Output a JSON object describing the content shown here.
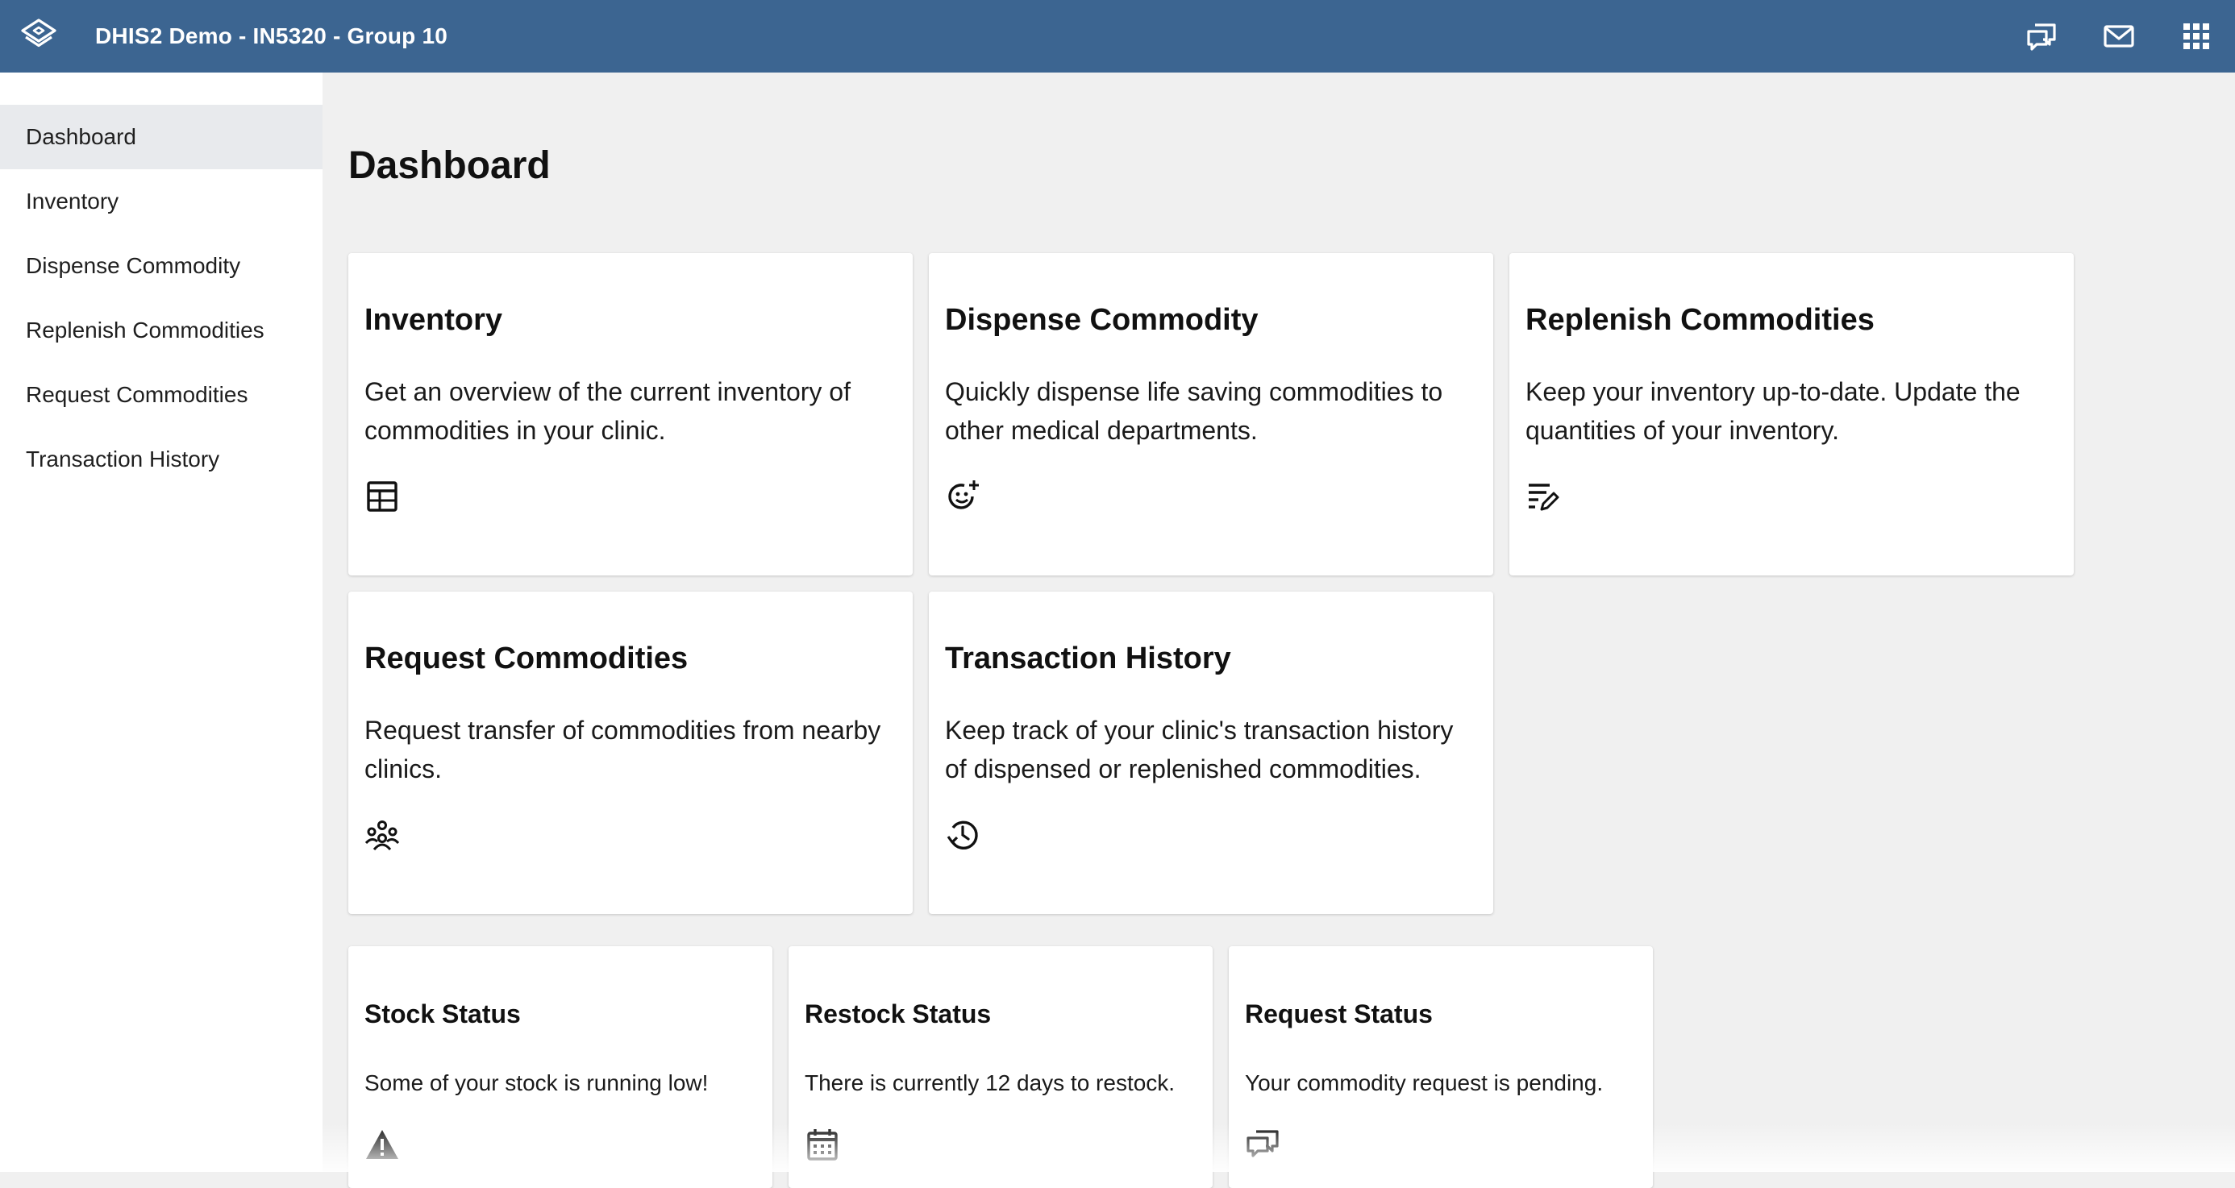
{
  "header": {
    "title": "DHIS2 Demo - IN5320 - Group 10",
    "logo_icon": "dhis2-layers-logo",
    "icons": [
      "interpretations-icon",
      "messages-icon",
      "apps-grid-icon"
    ],
    "bg_color": "#3c6591"
  },
  "sidebar": {
    "items": [
      {
        "label": "Dashboard",
        "active": true
      },
      {
        "label": "Inventory"
      },
      {
        "label": "Dispense Commodity"
      },
      {
        "label": "Replenish Commodities"
      },
      {
        "label": "Request Commodities"
      },
      {
        "label": "Transaction History"
      }
    ]
  },
  "main": {
    "title": "Dashboard",
    "cards": [
      {
        "title": "Inventory",
        "description": "Get an overview of the current inventory of commodities in your clinic.",
        "icon": "table-icon"
      },
      {
        "title": "Dispense Commodity",
        "description": "Quickly dispense life saving commodities to other medical departments.",
        "icon": "smiley-plus-icon"
      },
      {
        "title": "Replenish Commodities",
        "description": "Keep your inventory up-to-date. Update the quantities of your inventory.",
        "icon": "list-edit-icon"
      },
      {
        "title": "Request Commodities",
        "description": "Request transfer of commodities from nearby clinics.",
        "icon": "people-group-icon"
      },
      {
        "title": "Transaction History",
        "description": "Keep track of your clinic's transaction history of dispensed or replenished commodities.",
        "icon": "history-clock-icon"
      }
    ],
    "status_cards": [
      {
        "title": "Stock Status",
        "description": "Some of your stock is running low!",
        "icon": "warning-icon"
      },
      {
        "title": "Restock Status",
        "description": "There is currently 12 days to restock.",
        "icon": "calendar-icon"
      },
      {
        "title": "Request Status",
        "description": "Your commodity request is pending.",
        "icon": "chat-bubbles-icon"
      }
    ]
  }
}
